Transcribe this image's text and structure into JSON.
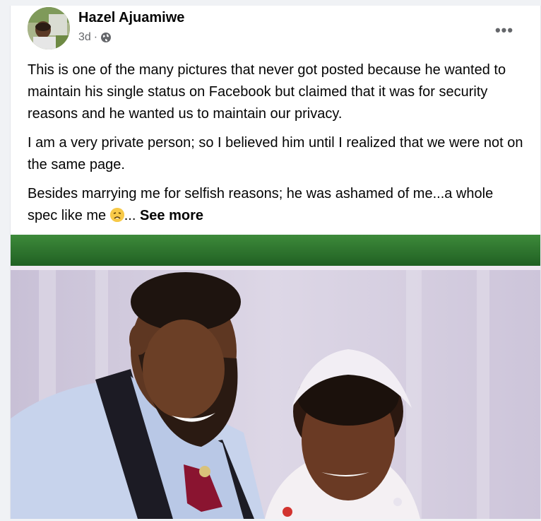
{
  "post": {
    "author": "Hazel Ajuamiwe",
    "timestamp": "3d",
    "separator": "·",
    "audience_icon": "globe-icon",
    "more_icon": "more-options-icon",
    "more_label": "•••",
    "paragraphs": [
      "This is one of the many pictures that never got posted because he wanted to maintain his single status on Facebook but claimed that it was for security reasons and he wanted us to maintain our privacy.",
      "I am a very private person; so I believed him until I realized that we were not on the same page."
    ],
    "last_paragraph_text": "Besides marrying me for selfish reasons; he was ashamed of me...a whole spec like me ",
    "emoji": "weary-face-emoji",
    "ellipsis": "...",
    "see_more": "See more"
  },
  "colors": {
    "text": "#050505",
    "secondary_text": "#65676b",
    "page_bg": "#f0f2f5",
    "card_bg": "#ffffff"
  }
}
